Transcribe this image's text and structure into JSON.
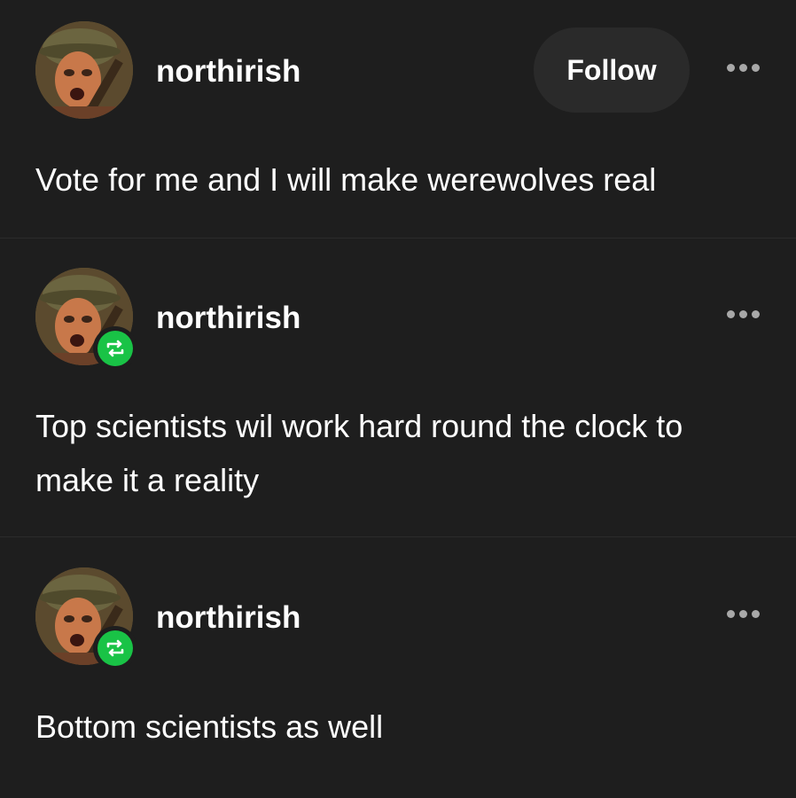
{
  "colors": {
    "background": "#1e1e1e",
    "text": "#ffffff",
    "follow_button_bg": "#2a2a2a",
    "more_dots": "#a8a8a8",
    "reblog_badge": "#19c346"
  },
  "posts": [
    {
      "username": "northirish",
      "text": "Vote for me and I will make werewolves real",
      "follow_label": "Follow",
      "avatar_icon": "avatar-soldier-icon",
      "more_icon": "more-options-icon",
      "reblogged": false
    },
    {
      "username": "northirish",
      "text": "Top scientists wil work hard round the clock to make it a reality",
      "avatar_icon": "avatar-soldier-icon",
      "badge_icon": "reblog-icon",
      "more_icon": "more-options-icon",
      "reblogged": true
    },
    {
      "username": "northirish",
      "text": "Bottom scientists as well",
      "avatar_icon": "avatar-soldier-icon",
      "badge_icon": "reblog-icon",
      "more_icon": "more-options-icon",
      "reblogged": true
    }
  ]
}
